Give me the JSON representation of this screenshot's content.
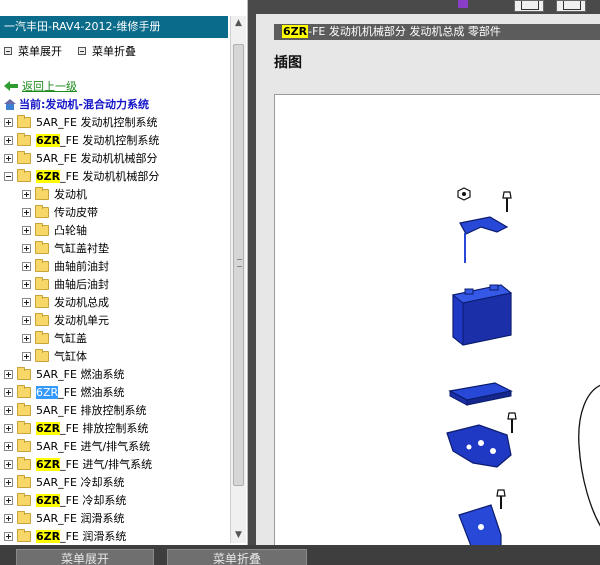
{
  "window": {
    "title": "一汽丰田-RAV4-2012-维修手册"
  },
  "toolbar": {
    "expand_label": "菜单展开",
    "collapse_label": "菜单折叠"
  },
  "tree": {
    "back_label": "返回上一级",
    "current_label": "当前:发动机-混合动力系统",
    "nodes": [
      {
        "level": 0,
        "expander": "plus",
        "code": "5AR",
        "suffix": "_FE 发动机控制系统",
        "highlight": "none"
      },
      {
        "level": 0,
        "expander": "plus",
        "code": "6ZR",
        "suffix": "_FE 发动机控制系统",
        "highlight": "yellow"
      },
      {
        "level": 0,
        "expander": "plus",
        "code": "5AR",
        "suffix": "_FE 发动机机械部分",
        "highlight": "none"
      },
      {
        "level": 0,
        "expander": "minus",
        "code": "6ZR",
        "suffix": "_FE 发动机机械部分",
        "highlight": "yellow"
      },
      {
        "level": 1,
        "expander": "plus",
        "code": "",
        "suffix": "发动机",
        "highlight": "none"
      },
      {
        "level": 1,
        "expander": "plus",
        "code": "",
        "suffix": "传动皮带",
        "highlight": "none"
      },
      {
        "level": 1,
        "expander": "plus",
        "code": "",
        "suffix": "凸轮轴",
        "highlight": "none"
      },
      {
        "level": 1,
        "expander": "plus",
        "code": "",
        "suffix": "气缸盖衬垫",
        "highlight": "none"
      },
      {
        "level": 1,
        "expander": "plus",
        "code": "",
        "suffix": "曲轴前油封",
        "highlight": "none"
      },
      {
        "level": 1,
        "expander": "plus",
        "code": "",
        "suffix": "曲轴后油封",
        "highlight": "none"
      },
      {
        "level": 1,
        "expander": "plus",
        "code": "",
        "suffix": "发动机总成",
        "highlight": "none"
      },
      {
        "level": 1,
        "expander": "plus",
        "code": "",
        "suffix": "发动机单元",
        "highlight": "none"
      },
      {
        "level": 1,
        "expander": "plus",
        "code": "",
        "suffix": "气缸盖",
        "highlight": "none"
      },
      {
        "level": 1,
        "expander": "plus",
        "code": "",
        "suffix": "气缸体",
        "highlight": "none"
      },
      {
        "level": 0,
        "expander": "plus",
        "code": "5AR",
        "suffix": "_FE 燃油系统",
        "highlight": "none"
      },
      {
        "level": 0,
        "expander": "plus",
        "code": "6ZR",
        "suffix": "_FE 燃油系统",
        "highlight": "blue"
      },
      {
        "level": 0,
        "expander": "plus",
        "code": "5AR",
        "suffix": "_FE 排放控制系统",
        "highlight": "none"
      },
      {
        "level": 0,
        "expander": "plus",
        "code": "6ZR",
        "suffix": "_FE 排放控制系统",
        "highlight": "yellow"
      },
      {
        "level": 0,
        "expander": "plus",
        "code": "5AR",
        "suffix": "_FE 进气/排气系统",
        "highlight": "none"
      },
      {
        "level": 0,
        "expander": "plus",
        "code": "6ZR",
        "suffix": "_FE 进气/排气系统",
        "highlight": "yellow"
      },
      {
        "level": 0,
        "expander": "plus",
        "code": "5AR",
        "suffix": "_FE 冷却系统",
        "highlight": "none"
      },
      {
        "level": 0,
        "expander": "plus",
        "code": "6ZR",
        "suffix": "_FE 冷却系统",
        "highlight": "yellow"
      },
      {
        "level": 0,
        "expander": "plus",
        "code": "5AR",
        "suffix": "_FE 润滑系统",
        "highlight": "none"
      },
      {
        "level": 0,
        "expander": "plus",
        "code": "6ZR",
        "suffix": "_FE 润滑系统",
        "highlight": "yellow"
      }
    ]
  },
  "right": {
    "breadcrumb_code": "6ZR",
    "breadcrumb_rest": "-FE 发动机机械部分  发动机总成  零部件",
    "section_title": "插图"
  },
  "bottom": {
    "left_button": "菜单展开",
    "right_button": "菜单折叠"
  },
  "colors": {
    "title_bar": "#0b6b8a",
    "part_blue": "#1f3fcf",
    "highlight_yellow": "#ffff00",
    "highlight_blue": "#3399ff"
  }
}
